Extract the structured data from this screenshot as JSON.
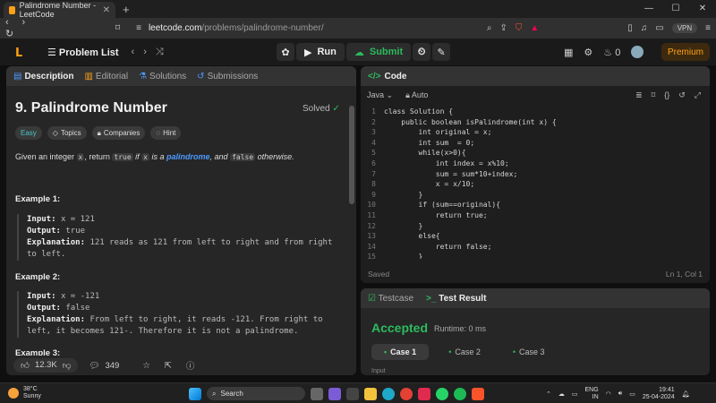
{
  "browser": {
    "tab_title": "Palindrome Number - LeetCode",
    "url_host": "leetcode.com",
    "url_path": "/problems/palindrome-number/",
    "vpn_label": "VPN"
  },
  "header": {
    "problem_list": "Problem List",
    "run_label": "Run",
    "submit_label": "Submit",
    "streak_count": "0",
    "premium_label": "Premium"
  },
  "left": {
    "tabs": [
      "Description",
      "Editorial",
      "Solutions",
      "Submissions"
    ],
    "title": "9. Palindrome Number",
    "solved": "Solved",
    "chips": [
      "Easy",
      "Topics",
      "Companies",
      "Hint"
    ],
    "desc": {
      "p1": "Given an integer ",
      "x": "x",
      "p2": ", return ",
      "t": "true",
      "p3": " if ",
      "x2": "x",
      "p4": " is a ",
      "link": "palindrome",
      "p5": ", and ",
      "f": "false",
      "p6": " otherwise."
    },
    "examples": [
      {
        "heading": "Example 1:",
        "input_label": "Input:",
        "input": "x = 121",
        "output_label": "Output:",
        "output": "true",
        "expl_label": "Explanation:",
        "expl": "121 reads as 121 from left to right and from right to left."
      },
      {
        "heading": "Example 2:",
        "input_label": "Input:",
        "input": "x = -121",
        "output_label": "Output:",
        "output": "false",
        "expl_label": "Explanation:",
        "expl": "From left to right, it reads -121. From right to left, it becomes 121-. Therefore it is not a palindrome."
      }
    ],
    "example3_heading": "Example 3:",
    "likes": "12.3K",
    "comments": "349"
  },
  "code": {
    "title": "Code",
    "language": "Java",
    "mode": "Auto",
    "saved": "Saved",
    "cursor": "Ln 1, Col 1",
    "lines": [
      "class Solution {",
      "    public boolean isPalindrome(int x) {",
      "        int original = x;",
      "        int sum  = 0;",
      "        while(x>0){",
      "            int index = x%10;",
      "            sum = sum*10+index;",
      "            x = x/10;",
      "        }",
      "        if (sum==original){",
      "            return true;",
      "        }",
      "        else{",
      "            return false;",
      "        }"
    ]
  },
  "result": {
    "tab_testcase": "Testcase",
    "tab_result": "Test Result",
    "status": "Accepted",
    "runtime": "Runtime: 0 ms",
    "cases": [
      "Case 1",
      "Case 2",
      "Case 3"
    ],
    "input_label": "Input"
  },
  "taskbar": {
    "temp": "38°C",
    "weather": "Sunny",
    "search": "Search",
    "lang1": "ENG",
    "lang2": "IN",
    "time": "19:41",
    "date": "25-04-2024"
  }
}
